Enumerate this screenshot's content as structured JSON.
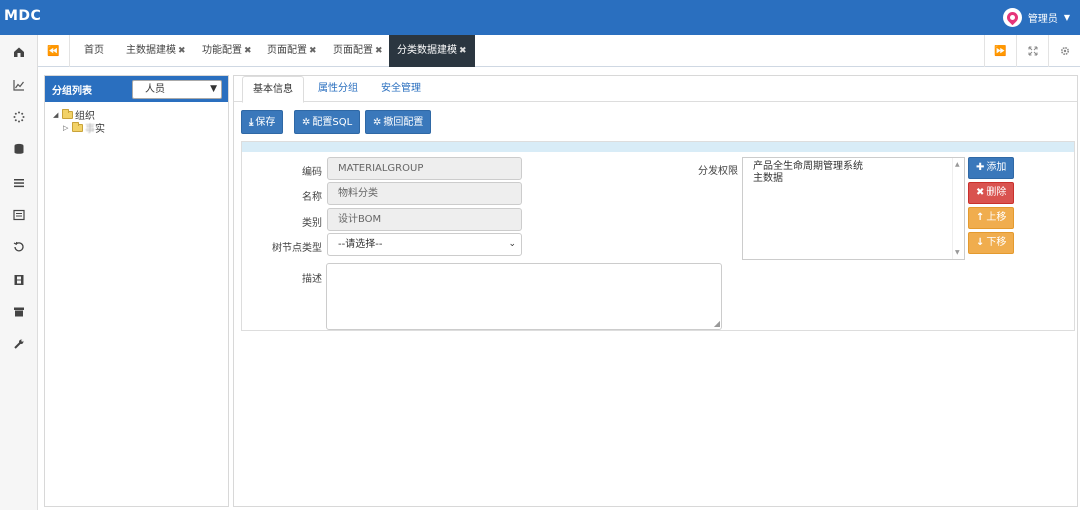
{
  "app": {
    "logo": "MDC",
    "user_name": "管理员"
  },
  "tabs": {
    "items": [
      {
        "label": "首页",
        "closable": false
      },
      {
        "label": "主数据建模",
        "closable": true
      },
      {
        "label": "功能配置",
        "closable": true
      },
      {
        "label": "页面配置",
        "closable": true
      },
      {
        "label": "页面配置",
        "closable": true
      },
      {
        "label": "分类数据建模",
        "closable": true,
        "active": true
      }
    ],
    "close_glyph": "✖"
  },
  "group_panel": {
    "title": "分组列表",
    "select_value": "人员",
    "tree": [
      {
        "label": "组织",
        "expanded": true
      },
      {
        "label": "实",
        "blurred_prefix": "事"
      }
    ]
  },
  "main": {
    "subtabs": [
      "基本信息",
      "属性分组",
      "安全管理"
    ],
    "active_subtab": 0,
    "toolbar": {
      "save": "保存",
      "config_sql": "配置SQL",
      "rollback": "撤回配置"
    },
    "form": {
      "code_label": "编码",
      "code_value": "MATERIALGROUP",
      "name_label": "名称",
      "name_value": "物料分类",
      "category_label": "类别",
      "category_value": "设计BOM",
      "node_type_label": "树节点类型",
      "node_type_value": "--请选择--",
      "desc_label": "描述",
      "perm_label": "分发权限",
      "perm_items": [
        "产品全生命周期管理系统",
        "主数据"
      ],
      "add": "添加",
      "delete": "删除",
      "up": "上移",
      "down": "下移"
    }
  },
  "colors": {
    "brand": "#2a6fbf",
    "active_tab": "#2b3640",
    "btn_primary": "#3a78bb",
    "btn_danger": "#d9534f",
    "btn_warning": "#f0ad4e"
  }
}
